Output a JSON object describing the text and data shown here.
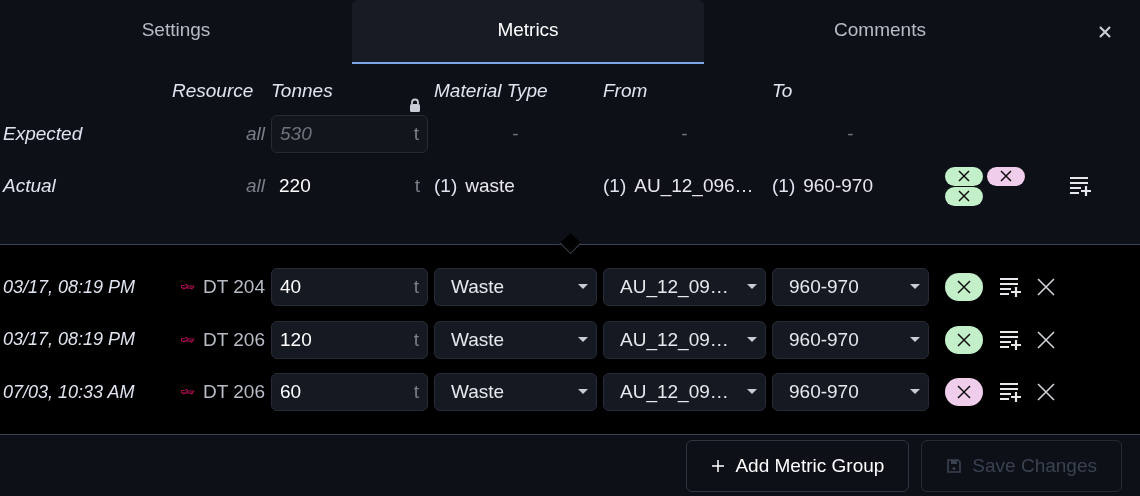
{
  "tabs": [
    {
      "label": "Settings",
      "selected": false
    },
    {
      "label": "Metrics",
      "selected": true
    },
    {
      "label": "Comments",
      "selected": false
    }
  ],
  "columns": [
    "Resource",
    "Tonnes",
    "Material Type",
    "From",
    "To"
  ],
  "expected": {
    "label": "Expected",
    "resource": "all",
    "tonnes": "530",
    "unit": "t",
    "locked": true,
    "material": "-",
    "from": "-",
    "to": "-"
  },
  "actual": {
    "label": "Actual",
    "resource": "all",
    "tonnes": "220",
    "unit": "t",
    "material_count": "(1)",
    "material": "waste",
    "from_count": "(1)",
    "from": "AU_12_096…",
    "to_count": "(1)",
    "to": "960-970",
    "chips": [
      {
        "color": "#c3f0c8"
      },
      {
        "color": "#f0cdea"
      },
      {
        "color": "#c3f0c8"
      }
    ]
  },
  "rows": [
    {
      "time": "03/17, 08:19 PM",
      "vehicle": "DT 204",
      "tonnes": "40",
      "unit": "t",
      "material": "Waste",
      "from": "AU_12_09…",
      "to": "960-970",
      "color": "#c3f0c8"
    },
    {
      "time": "03/17, 08:19 PM",
      "vehicle": "DT 206",
      "tonnes": "120",
      "unit": "t",
      "material": "Waste",
      "from": "AU_12_09…",
      "to": "960-970",
      "color": "#c3f0c8"
    },
    {
      "time": "07/03, 10:33 AM",
      "vehicle": "DT 206",
      "tonnes": "60",
      "unit": "t",
      "material": "Waste",
      "from": "AU_12_09…",
      "to": "960-970",
      "color": "#f0cdea"
    }
  ],
  "buttons": [
    {
      "label": "Add Metric Group",
      "kind": "add",
      "disabled": false
    },
    {
      "label": "Save Changes",
      "kind": "save",
      "disabled": true
    }
  ]
}
